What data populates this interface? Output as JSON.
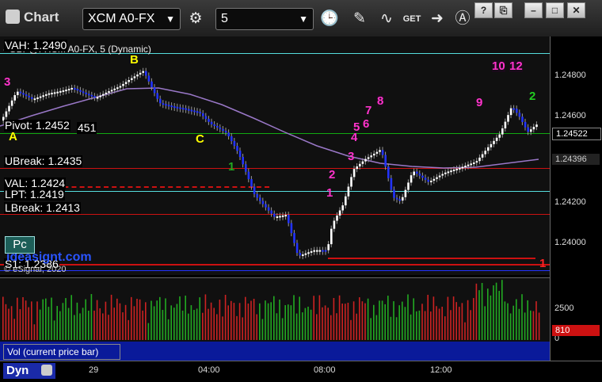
{
  "window": {
    "title": "Chart",
    "symbol": "XCM A0-FX",
    "interval": "5"
  },
  "chart": {
    "legend": "- GBP@FXCM A0-FX, 5 (Dynamic)",
    "copyright": "© eSignal, 2020",
    "watermark": "ideasignt.com",
    "levels": {
      "vah": "VAH: 1.2490",
      "pivot": "Pivot: 1.2452",
      "pivot_num": "451",
      "ubreak": "UBreak: 1.2435",
      "val": "VAL: 1.2424",
      "lpt": "LPT: 1.2419",
      "lbreak": "LBreak: 1.2413",
      "s1": "S1: 1.2386"
    },
    "price_axis": [
      "1.24800",
      "1.24600",
      "1.24200",
      "1.24000"
    ],
    "current_price": "1.24522",
    "ma_price": "1.24396",
    "point_labels": {
      "a": "A",
      "b": "B",
      "c": "C"
    },
    "count_markers": [
      "3",
      "1",
      "2",
      "3",
      "4",
      "5",
      "6",
      "7",
      "8",
      "9",
      "10",
      "12",
      "2",
      "1",
      "1"
    ],
    "pc_button": "Pc"
  },
  "volume": {
    "label": "Vol (current price bar)",
    "axis": [
      "2500",
      "0"
    ],
    "current": "810"
  },
  "time_axis": {
    "dyn": "Dyn",
    "labels": [
      "29",
      "04:00",
      "08:00",
      "12:00"
    ]
  },
  "colors": {
    "up": "#ffffff",
    "down": "#2233ff",
    "level_red": "#cc1111",
    "level_cyan": "#55dddd",
    "level_green": "#11aa11",
    "ma": "#9a78c8",
    "marker": "#ff33cc"
  }
}
